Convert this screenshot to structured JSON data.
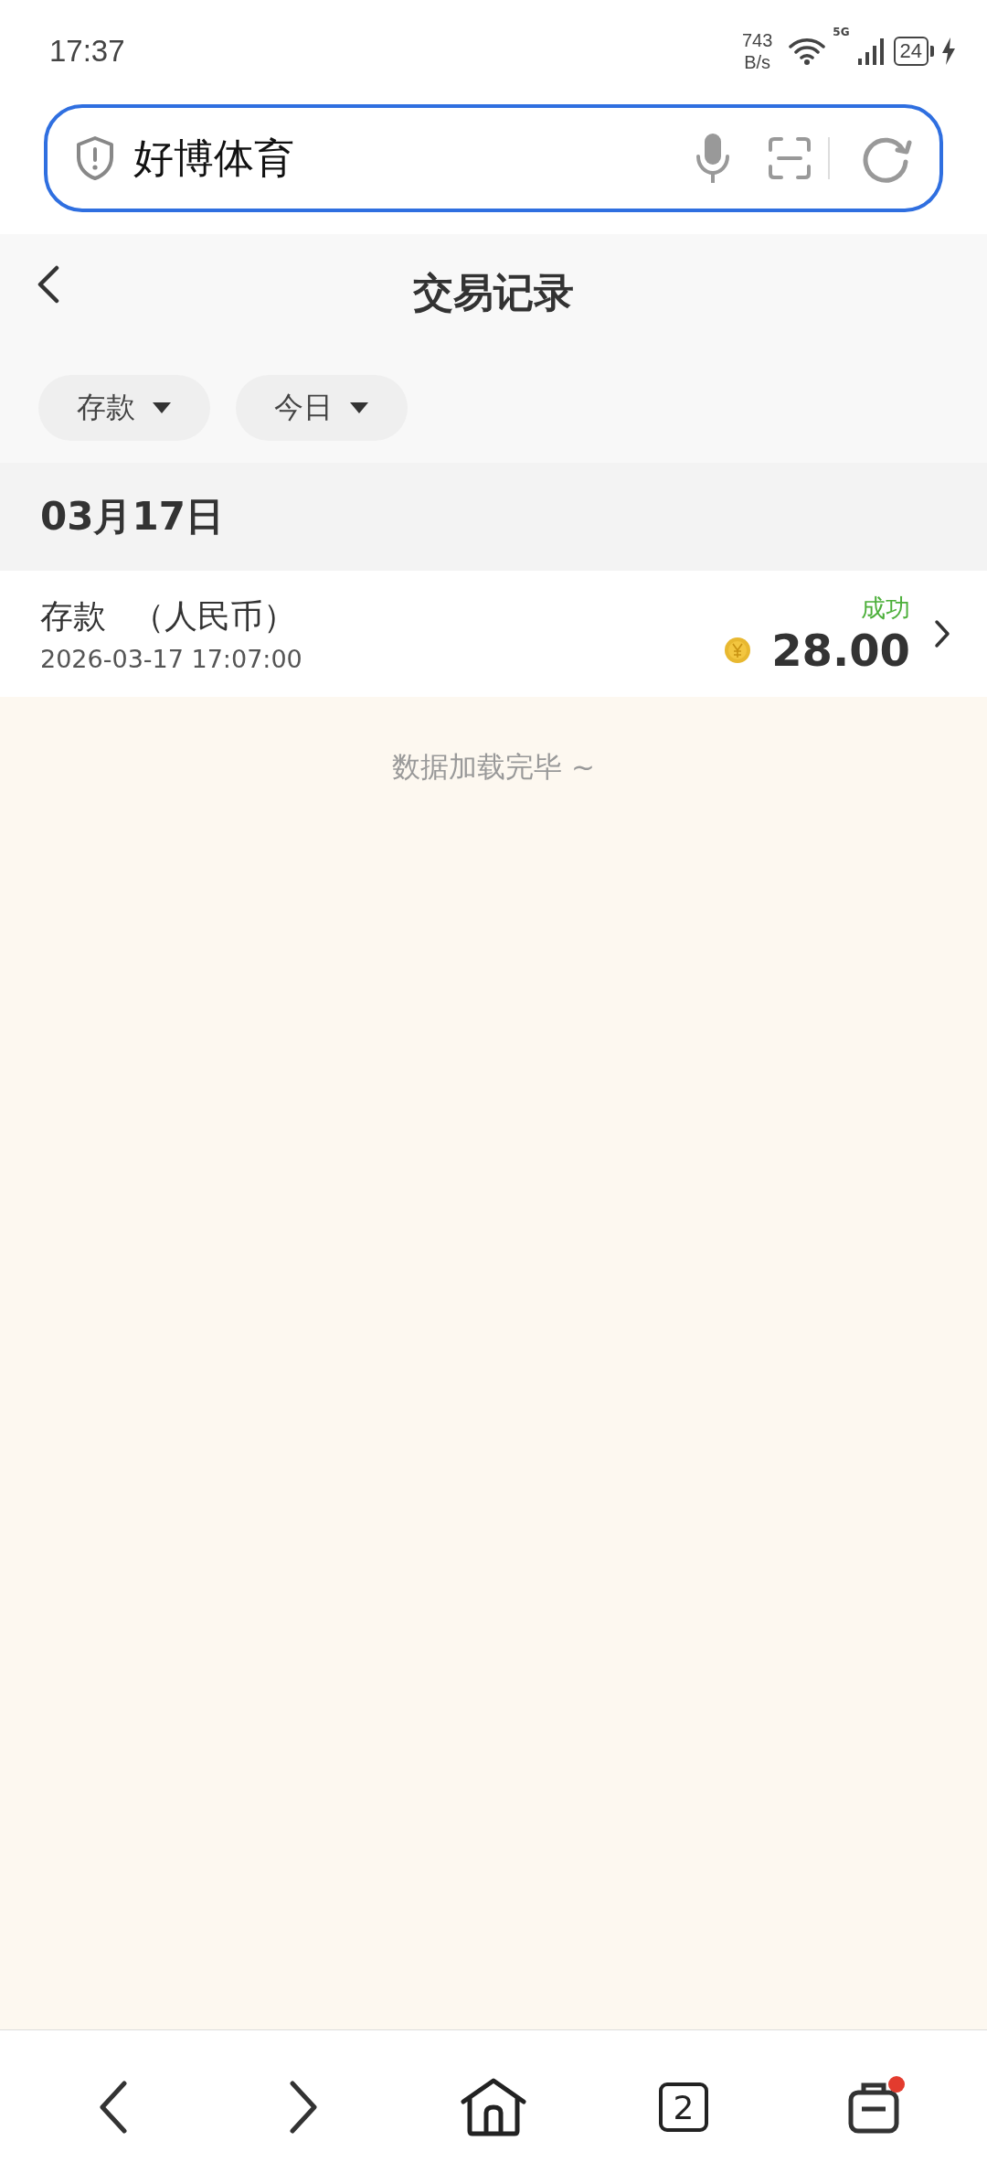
{
  "status_bar": {
    "time": "17:37",
    "net_speed": "743",
    "net_unit": "B/s",
    "network": "5G",
    "battery": "24",
    "charging": true
  },
  "address_bar": {
    "value": "好博体育"
  },
  "header": {
    "title": "交易记录"
  },
  "filters": [
    {
      "label": "存款"
    },
    {
      "label": "今日"
    }
  ],
  "sections": [
    {
      "date": "03月17日",
      "records": [
        {
          "type": "存款",
          "currency": "（人民币）",
          "time": "2026-03-17 17:07:00",
          "status": "成功",
          "amount": "28.00"
        }
      ]
    }
  ],
  "footer": {
    "text": "数据加载完毕 ~"
  },
  "bottom_nav": {
    "tabs_count": "2",
    "notification": true
  }
}
